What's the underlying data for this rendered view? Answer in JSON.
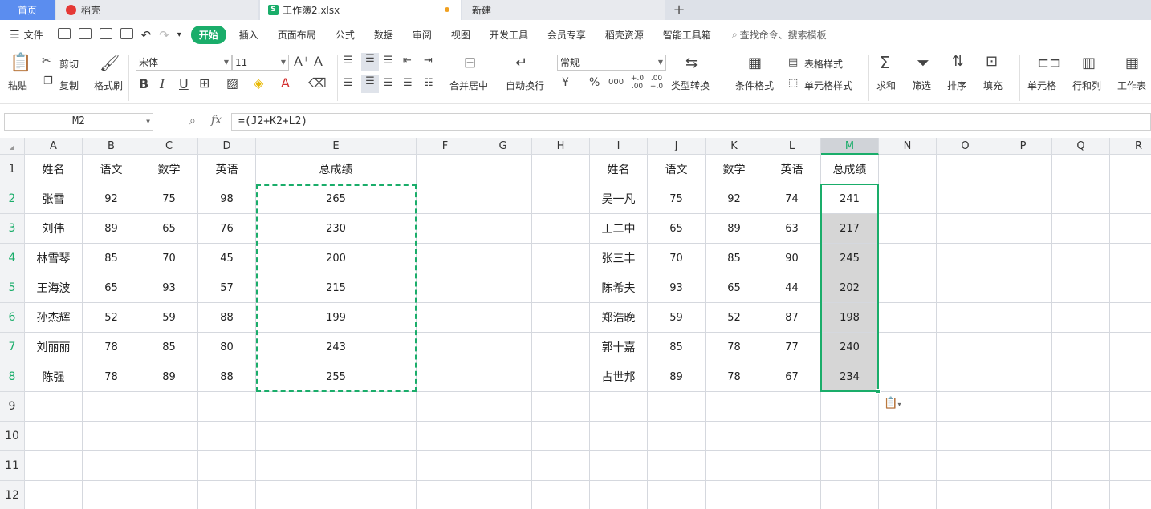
{
  "tabs": {
    "home": "首页",
    "daoke": "稻壳",
    "doc": "工作簿2.xlsx",
    "new": "新建",
    "plus": "+"
  },
  "menu": {
    "file": "文件",
    "start": "开始",
    "items": [
      "插入",
      "页面布局",
      "公式",
      "数据",
      "审阅",
      "视图",
      "开发工具",
      "会员专享",
      "稻壳资源",
      "智能工具箱"
    ],
    "search": "查找命令、搜索模板"
  },
  "ribbon": {
    "paste": "粘贴",
    "cut": "剪切",
    "copy": "复制",
    "format_painter": "格式刷",
    "font_name": "宋体",
    "font_size": "11",
    "merge_center": "合并居中",
    "wrap": "自动换行",
    "number_format": "常规",
    "type_convert": "类型转换",
    "cond_format": "条件格式",
    "table_style": "表格样式",
    "cell_style": "单元格样式",
    "sum": "求和",
    "filter": "筛选",
    "sort": "排序",
    "fill": "填充",
    "cell": "单元格",
    "row_col": "行和列",
    "sheet": "工作表",
    "currency": "¥",
    "percent": "%",
    "thousands": "000",
    "inc_dec": "+.0 .00",
    "dec_dec": ".00 +.0"
  },
  "formula_bar": {
    "name_box": "M2",
    "fx": "fx",
    "formula": "=(J2+K2+L2)"
  },
  "columns": [
    "A",
    "B",
    "C",
    "D",
    "E",
    "F",
    "G",
    "H",
    "I",
    "J",
    "K",
    "L",
    "M",
    "N",
    "O",
    "P",
    "Q",
    "R"
  ],
  "rows": [
    "1",
    "2",
    "3",
    "4",
    "5",
    "6",
    "7",
    "8",
    "9",
    "10",
    "11",
    "12"
  ],
  "table1": {
    "headers": [
      "姓名",
      "语文",
      "数学",
      "英语",
      "总成绩"
    ],
    "rows": [
      [
        "张雪",
        "92",
        "75",
        "98",
        "265"
      ],
      [
        "刘伟",
        "89",
        "65",
        "76",
        "230"
      ],
      [
        "林雪琴",
        "85",
        "70",
        "45",
        "200"
      ],
      [
        "王海波",
        "65",
        "93",
        "57",
        "215"
      ],
      [
        "孙杰辉",
        "52",
        "59",
        "88",
        "199"
      ],
      [
        "刘丽丽",
        "78",
        "85",
        "80",
        "243"
      ],
      [
        "陈强",
        "78",
        "89",
        "88",
        "255"
      ]
    ]
  },
  "table2": {
    "headers": [
      "姓名",
      "语文",
      "数学",
      "英语",
      "总成绩"
    ],
    "rows": [
      [
        "吴一凡",
        "75",
        "92",
        "74",
        "241"
      ],
      [
        "王二中",
        "65",
        "89",
        "63",
        "217"
      ],
      [
        "张三丰",
        "70",
        "85",
        "90",
        "245"
      ],
      [
        "陈希夫",
        "93",
        "65",
        "44",
        "202"
      ],
      [
        "郑浩晚",
        "59",
        "52",
        "87",
        "198"
      ],
      [
        "郭十嘉",
        "85",
        "78",
        "77",
        "240"
      ],
      [
        "占世邦",
        "89",
        "78",
        "67",
        "234"
      ]
    ]
  },
  "colors": {
    "accent": "#1aad6a",
    "home_tab": "#5b8def",
    "selection_shade": "#d6d6d6"
  }
}
